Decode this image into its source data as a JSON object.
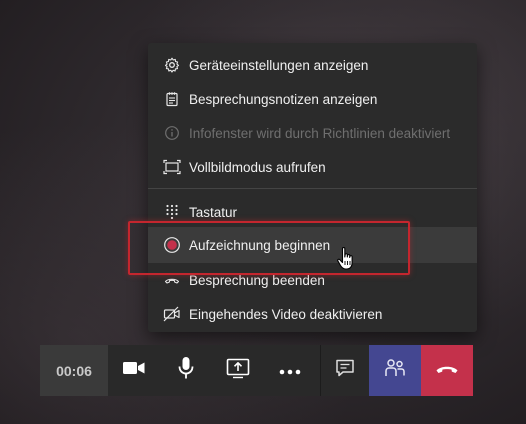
{
  "menu": {
    "items": [
      {
        "label": "Geräteeinstellungen anzeigen",
        "icon": "gear-icon",
        "enabled": true
      },
      {
        "label": "Besprechungsnotizen anzeigen",
        "icon": "notes-icon",
        "enabled": true
      },
      {
        "label": "Infofenster wird durch Richtlinien deaktiviert",
        "icon": "info-icon",
        "enabled": false
      },
      {
        "label": "Vollbildmodus aufrufen",
        "icon": "fullscreen-icon",
        "enabled": true
      },
      {
        "label": "Tastatur",
        "icon": "keypad-icon",
        "enabled": true
      },
      {
        "label": "Aufzeichnung beginnen",
        "icon": "record-icon",
        "enabled": true,
        "hovered": true
      },
      {
        "label": "Besprechung beenden",
        "icon": "end-meeting-icon",
        "enabled": true
      },
      {
        "label": "Eingehendes Video deaktivieren",
        "icon": "video-off-icon",
        "enabled": true
      }
    ]
  },
  "callbar": {
    "timer": "00:06",
    "buttons": [
      "camera-icon",
      "microphone-icon",
      "share-screen-icon",
      "more-options-icon",
      "chat-icon",
      "participants-icon",
      "hang-up-icon"
    ]
  },
  "colors": {
    "record": "#c4314b",
    "highlight": "#c4262e",
    "participants_bg": "#444791",
    "hangup_bg": "#c4314b"
  }
}
